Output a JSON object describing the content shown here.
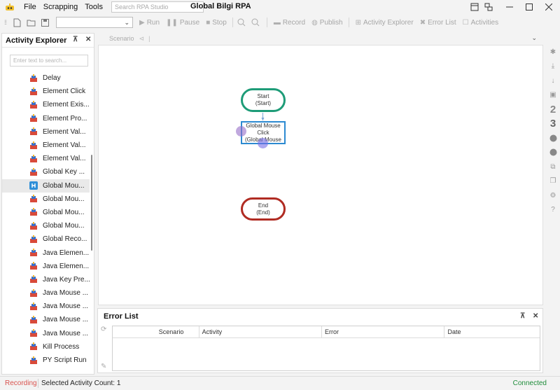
{
  "app": {
    "title": "Global Bilgi RPA",
    "search_placeholder": "Search RPA Studio",
    "menu": [
      "File",
      "Scrapping",
      "Tools"
    ]
  },
  "toolbar": {
    "scenario_dropdown": "",
    "buttons": {
      "run": "Run",
      "pause": "Pause",
      "stop": "Stop",
      "record": "Record",
      "publish": "Publish",
      "activity_explorer": "Activity Explorer",
      "error_list": "Error List",
      "activities": "Activities"
    }
  },
  "activity_explorer": {
    "title": "Activity Explorer",
    "filter_placeholder": "Enter text to search...",
    "items": [
      {
        "label": "Delay",
        "icon": "activity-icon"
      },
      {
        "label": "Element Click",
        "icon": "activity-icon"
      },
      {
        "label": "Element Exis...",
        "icon": "activity-icon"
      },
      {
        "label": "Element Pro...",
        "icon": "activity-icon"
      },
      {
        "label": "Element Val...",
        "icon": "activity-icon"
      },
      {
        "label": "Element Val...",
        "icon": "activity-icon"
      },
      {
        "label": "Element Val...",
        "icon": "activity-icon"
      },
      {
        "label": "Global Key ...",
        "icon": "activity-icon"
      },
      {
        "label": "Global Mou...",
        "icon": "global-mouse-icon",
        "selected": true
      },
      {
        "label": "Global Mou...",
        "icon": "activity-icon"
      },
      {
        "label": "Global Mou...",
        "icon": "activity-icon"
      },
      {
        "label": "Global Mou...",
        "icon": "activity-icon"
      },
      {
        "label": "Global Reco...",
        "icon": "activity-icon"
      },
      {
        "label": "Java Elemen...",
        "icon": "activity-icon"
      },
      {
        "label": "Java Elemen...",
        "icon": "activity-icon"
      },
      {
        "label": "Java Key Pre...",
        "icon": "activity-icon"
      },
      {
        "label": "Java Mouse ...",
        "icon": "activity-icon"
      },
      {
        "label": "Java Mouse ...",
        "icon": "activity-icon"
      },
      {
        "label": "Java Mouse ...",
        "icon": "activity-icon"
      },
      {
        "label": "Java Mouse ...",
        "icon": "activity-icon"
      },
      {
        "label": "Kill Process",
        "icon": "activity-icon"
      },
      {
        "label": "PY Script Run",
        "icon": "activity-icon"
      }
    ]
  },
  "scenario": {
    "tab_label": "Scenario",
    "nodes": {
      "start": {
        "line1": "Start",
        "line2": "(Start)"
      },
      "activity": {
        "line1": "Global Mouse",
        "line2": "Click",
        "line3": "(Global Mouse"
      },
      "end": {
        "line1": "End",
        "line2": "(End)"
      }
    }
  },
  "error_list": {
    "title": "Error List",
    "columns": [
      "Scenario",
      "Activity",
      "Error",
      "Date"
    ]
  },
  "status": {
    "recording": "Recording",
    "selected_count": "Selected Activity Count: 1",
    "connection": "Connected"
  },
  "colors": {
    "start_border": "#1e9c78",
    "end_border": "#b02b22",
    "activity_border": "#2c8ad1",
    "recording_text": "#d9534f",
    "connected_text": "#1e8c3a"
  }
}
